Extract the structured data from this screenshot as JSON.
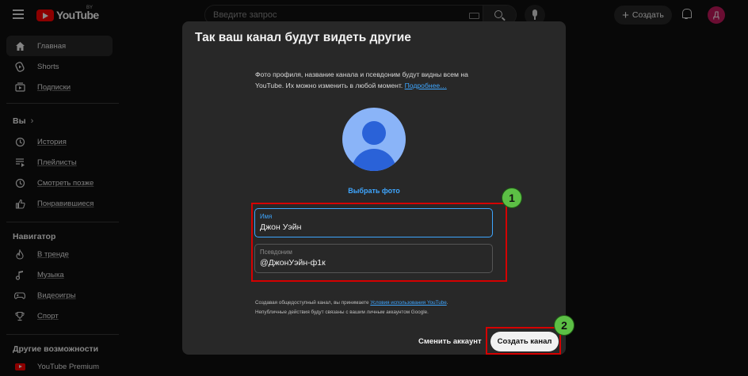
{
  "header": {
    "logo_text": "YouTube",
    "region": "BY",
    "search_placeholder": "Введите запрос",
    "create_label": "Создать",
    "avatar_letter": "Д"
  },
  "sidebar": {
    "main": [
      {
        "label": "Главная",
        "icon": "home-icon",
        "active": true
      },
      {
        "label": "Shorts",
        "icon": "shorts-icon"
      },
      {
        "label": "Подписки",
        "icon": "subscriptions-icon"
      }
    ],
    "you_header": "Вы",
    "you": [
      {
        "label": "История",
        "icon": "history-icon"
      },
      {
        "label": "Плейлисты",
        "icon": "playlists-icon"
      },
      {
        "label": "Смотреть позже",
        "icon": "watch-later-icon"
      },
      {
        "label": "Понравившиеся",
        "icon": "like-icon"
      }
    ],
    "navigator_header": "Навигатор",
    "navigator": [
      {
        "label": "В тренде",
        "icon": "trending-icon"
      },
      {
        "label": "Музыка",
        "icon": "music-icon"
      },
      {
        "label": "Видеоигры",
        "icon": "gaming-icon"
      },
      {
        "label": "Спорт",
        "icon": "sports-icon"
      }
    ],
    "more_header": "Другие возможности",
    "more": [
      {
        "label": "YouTube Premium",
        "icon": "youtube-premium-icon"
      }
    ]
  },
  "dialog": {
    "title": "Так ваш канал будут видеть другие",
    "description": "Фото профиля, название канала и псевдоним будут видны всем на YouTube. Их можно изменить в любой момент.",
    "learn_more": "Подробнее…",
    "choose_photo": "Выбрать фото",
    "name_label": "Имя",
    "name_value": "Джон Уэйн",
    "handle_label": "Псевдоним",
    "handle_value": "@ДжонУэйн-ф1к",
    "terms_prefix": "Создавая общедоступный канал, вы принимаете",
    "terms_link": "Условия использования YouTube",
    "terms_suffix": ".",
    "terms_line2": "Непубличные действия будут связаны с вашим личным аккаунтом Google.",
    "switch_account": "Сменить аккаунт",
    "create_channel": "Создать канал"
  },
  "annotations": {
    "badge_1": "1",
    "badge_2": "2",
    "color_box": "#d50000",
    "color_badge": "#5cbf45"
  },
  "colors": {
    "background": "#0f0f0f",
    "dialog": "#282828",
    "accent_link": "#3ea6ff",
    "brand_red": "#ff0000"
  }
}
